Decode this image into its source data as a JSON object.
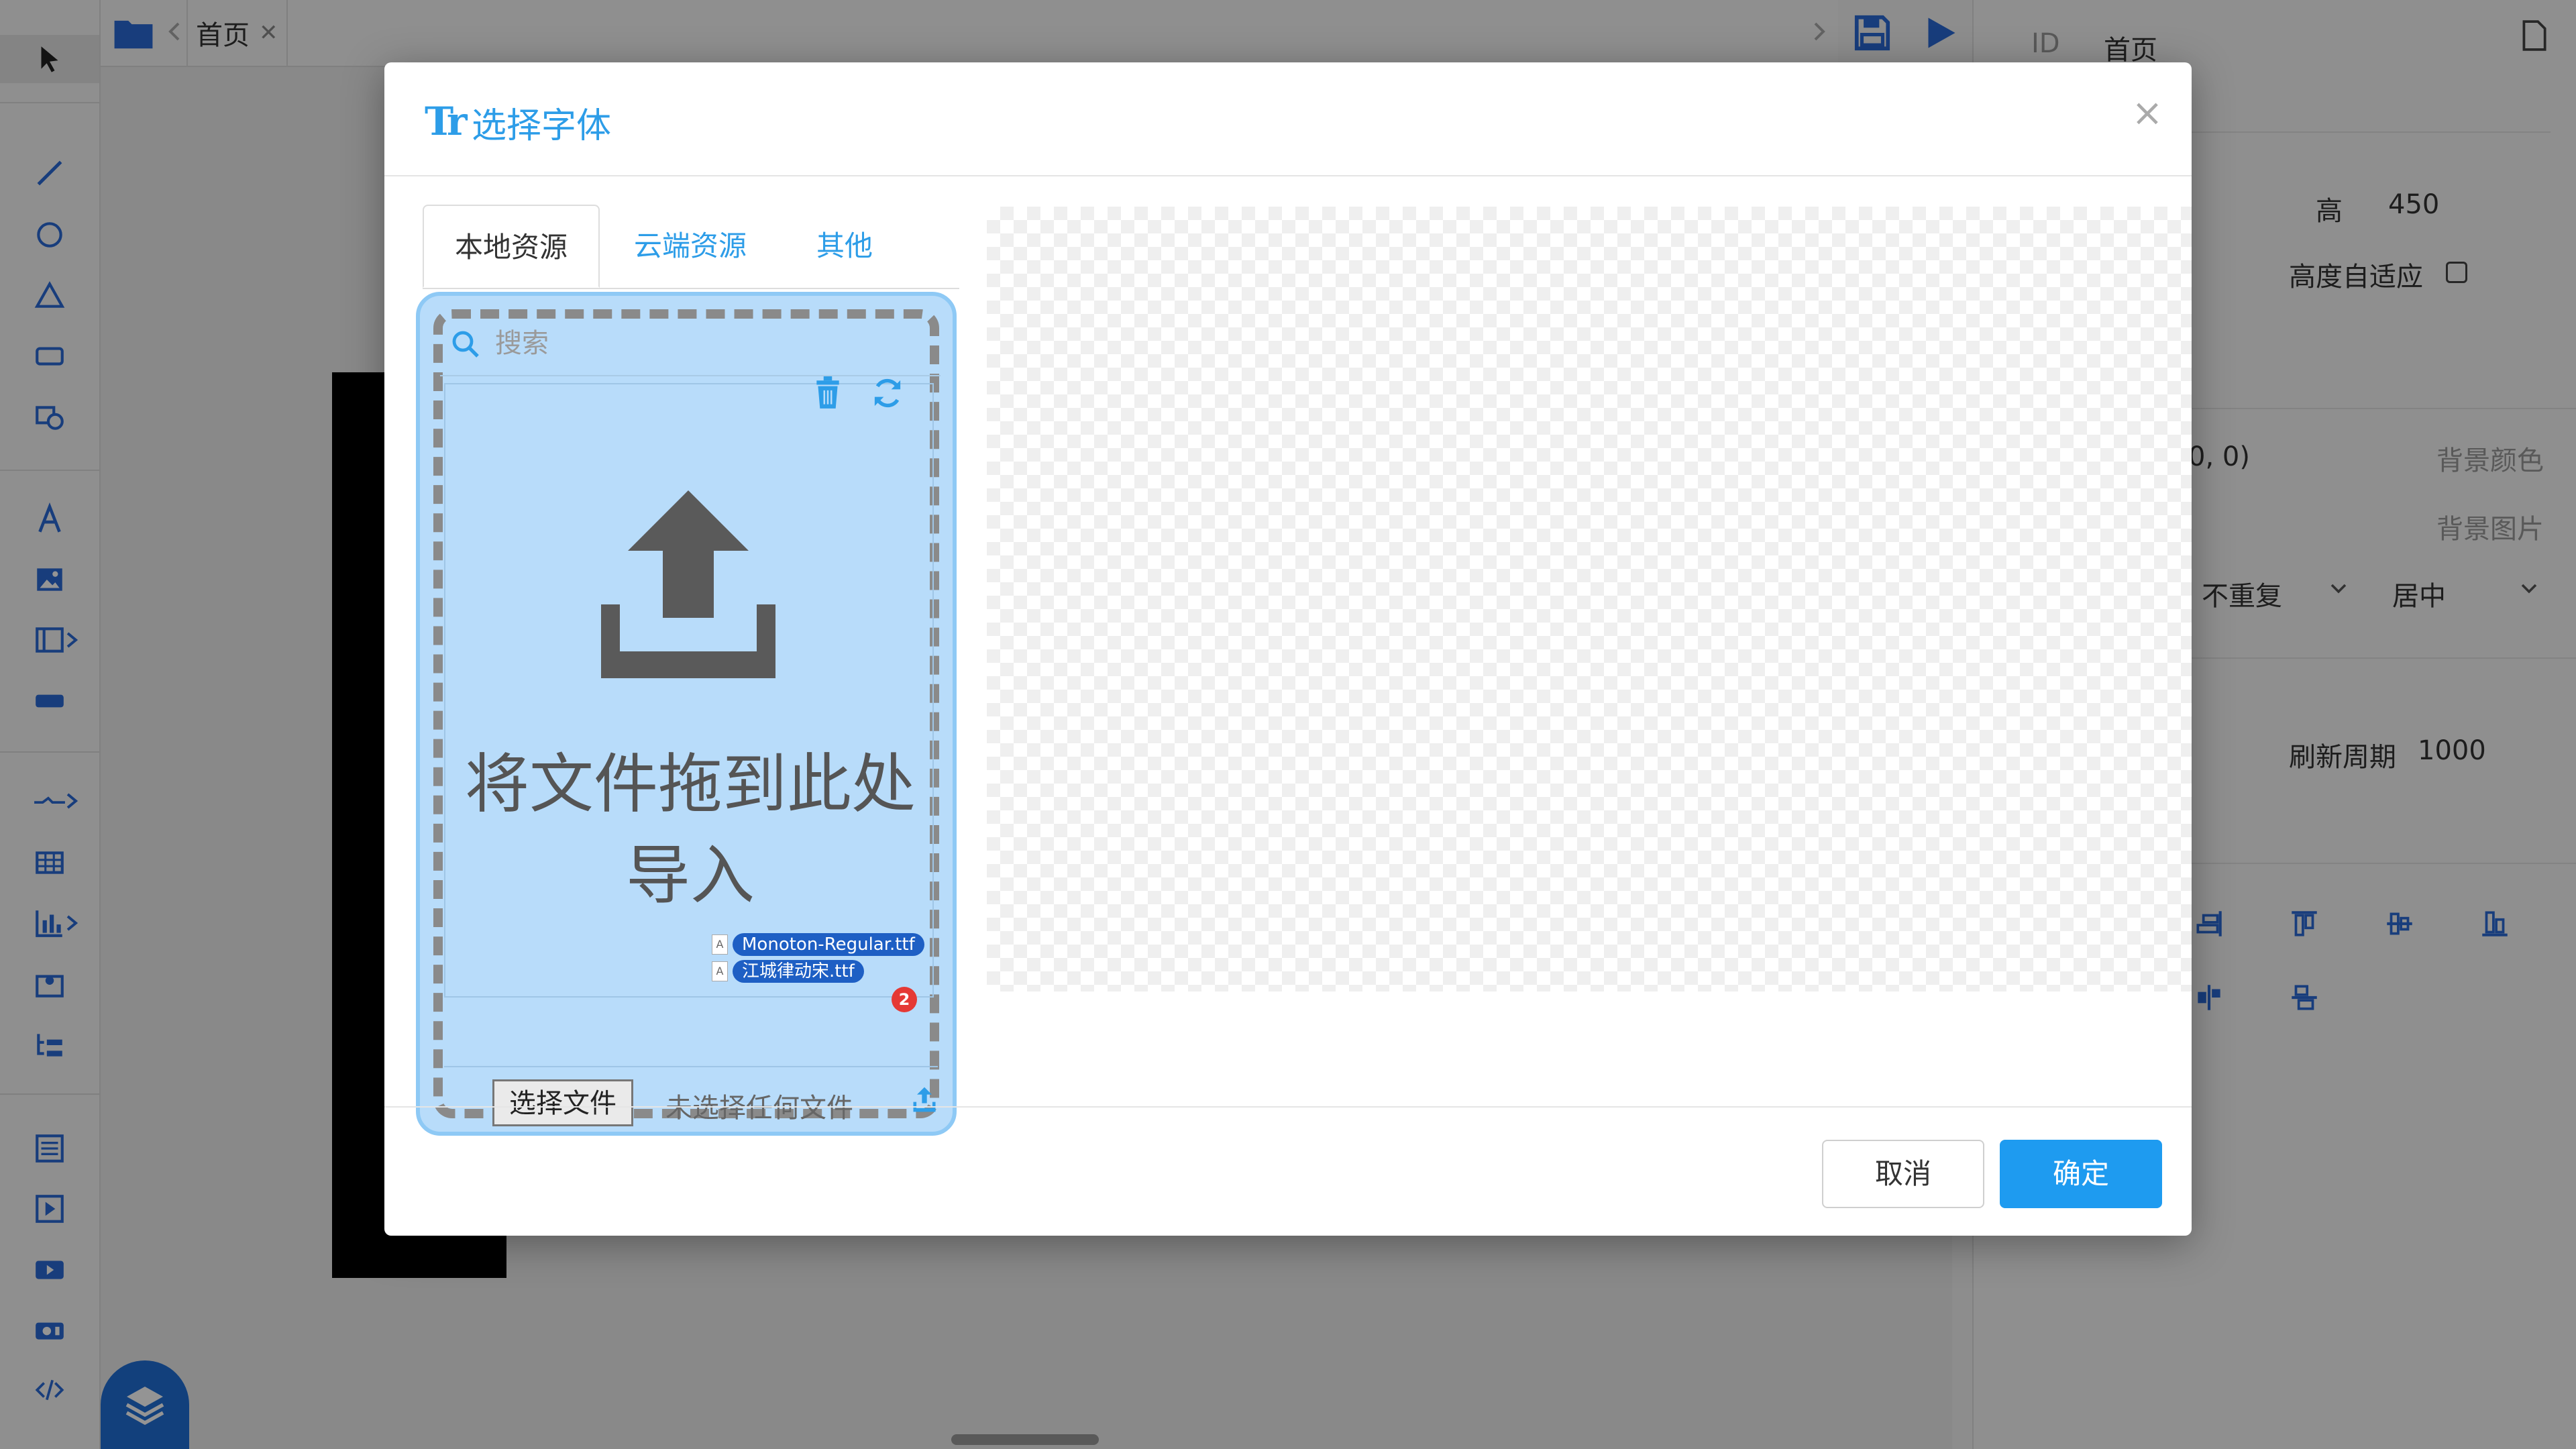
{
  "tabbar": {
    "tab_label": "首页",
    "close_glyph": "✕"
  },
  "right_panel": {
    "id_label": "ID",
    "id_value": "首页",
    "height_label": "高",
    "height_value": "450",
    "auto_height_label": "高度自适应",
    "coord_fragment": "0, 0)",
    "bg_color_label": "背景颜色",
    "bg_image_label": "背景图片",
    "repeat_value": "不重复",
    "position_value": "居中",
    "refresh_label": "刷新周期",
    "refresh_value": "1000"
  },
  "modal": {
    "title": "选择字体",
    "title_icon": "Tr",
    "close_glyph": "×",
    "tabs": [
      {
        "label": "本地资源",
        "active": true
      },
      {
        "label": "云端资源",
        "active": false
      },
      {
        "label": "其他",
        "active": false
      }
    ],
    "search": {
      "placeholder": "搜索"
    },
    "dropzone": {
      "text": "将文件拖到此处导入",
      "files": [
        "Monoton-Regular.ttf",
        "江城律动宋.ttf"
      ],
      "file_count": "2",
      "choose_button": "选择文件",
      "no_file_text": "未选择任何文件"
    },
    "footer": {
      "cancel": "取消",
      "ok": "确定"
    }
  },
  "colors": {
    "accent": "#2d9de8",
    "primary_button": "#1e9bf0",
    "dropzone_bg": "#b8dcfa",
    "chip": "#1e5fc4",
    "badge": "#e53935"
  },
  "icons": [
    "cursor-icon",
    "line-icon",
    "circle-icon",
    "triangle-icon",
    "rectangle-icon",
    "shape-icon",
    "text-icon",
    "image-icon",
    "panel-icon",
    "button-icon",
    "connector-icon",
    "table-icon",
    "chart-icon",
    "map-icon",
    "tree-icon",
    "list-icon",
    "media-icon",
    "video-icon",
    "camera-icon",
    "code-icon",
    "folder-icon",
    "save-icon",
    "play-icon",
    "page-icon",
    "trash-icon",
    "refresh-icon",
    "upload-icon",
    "search-icon",
    "layers-icon"
  ]
}
